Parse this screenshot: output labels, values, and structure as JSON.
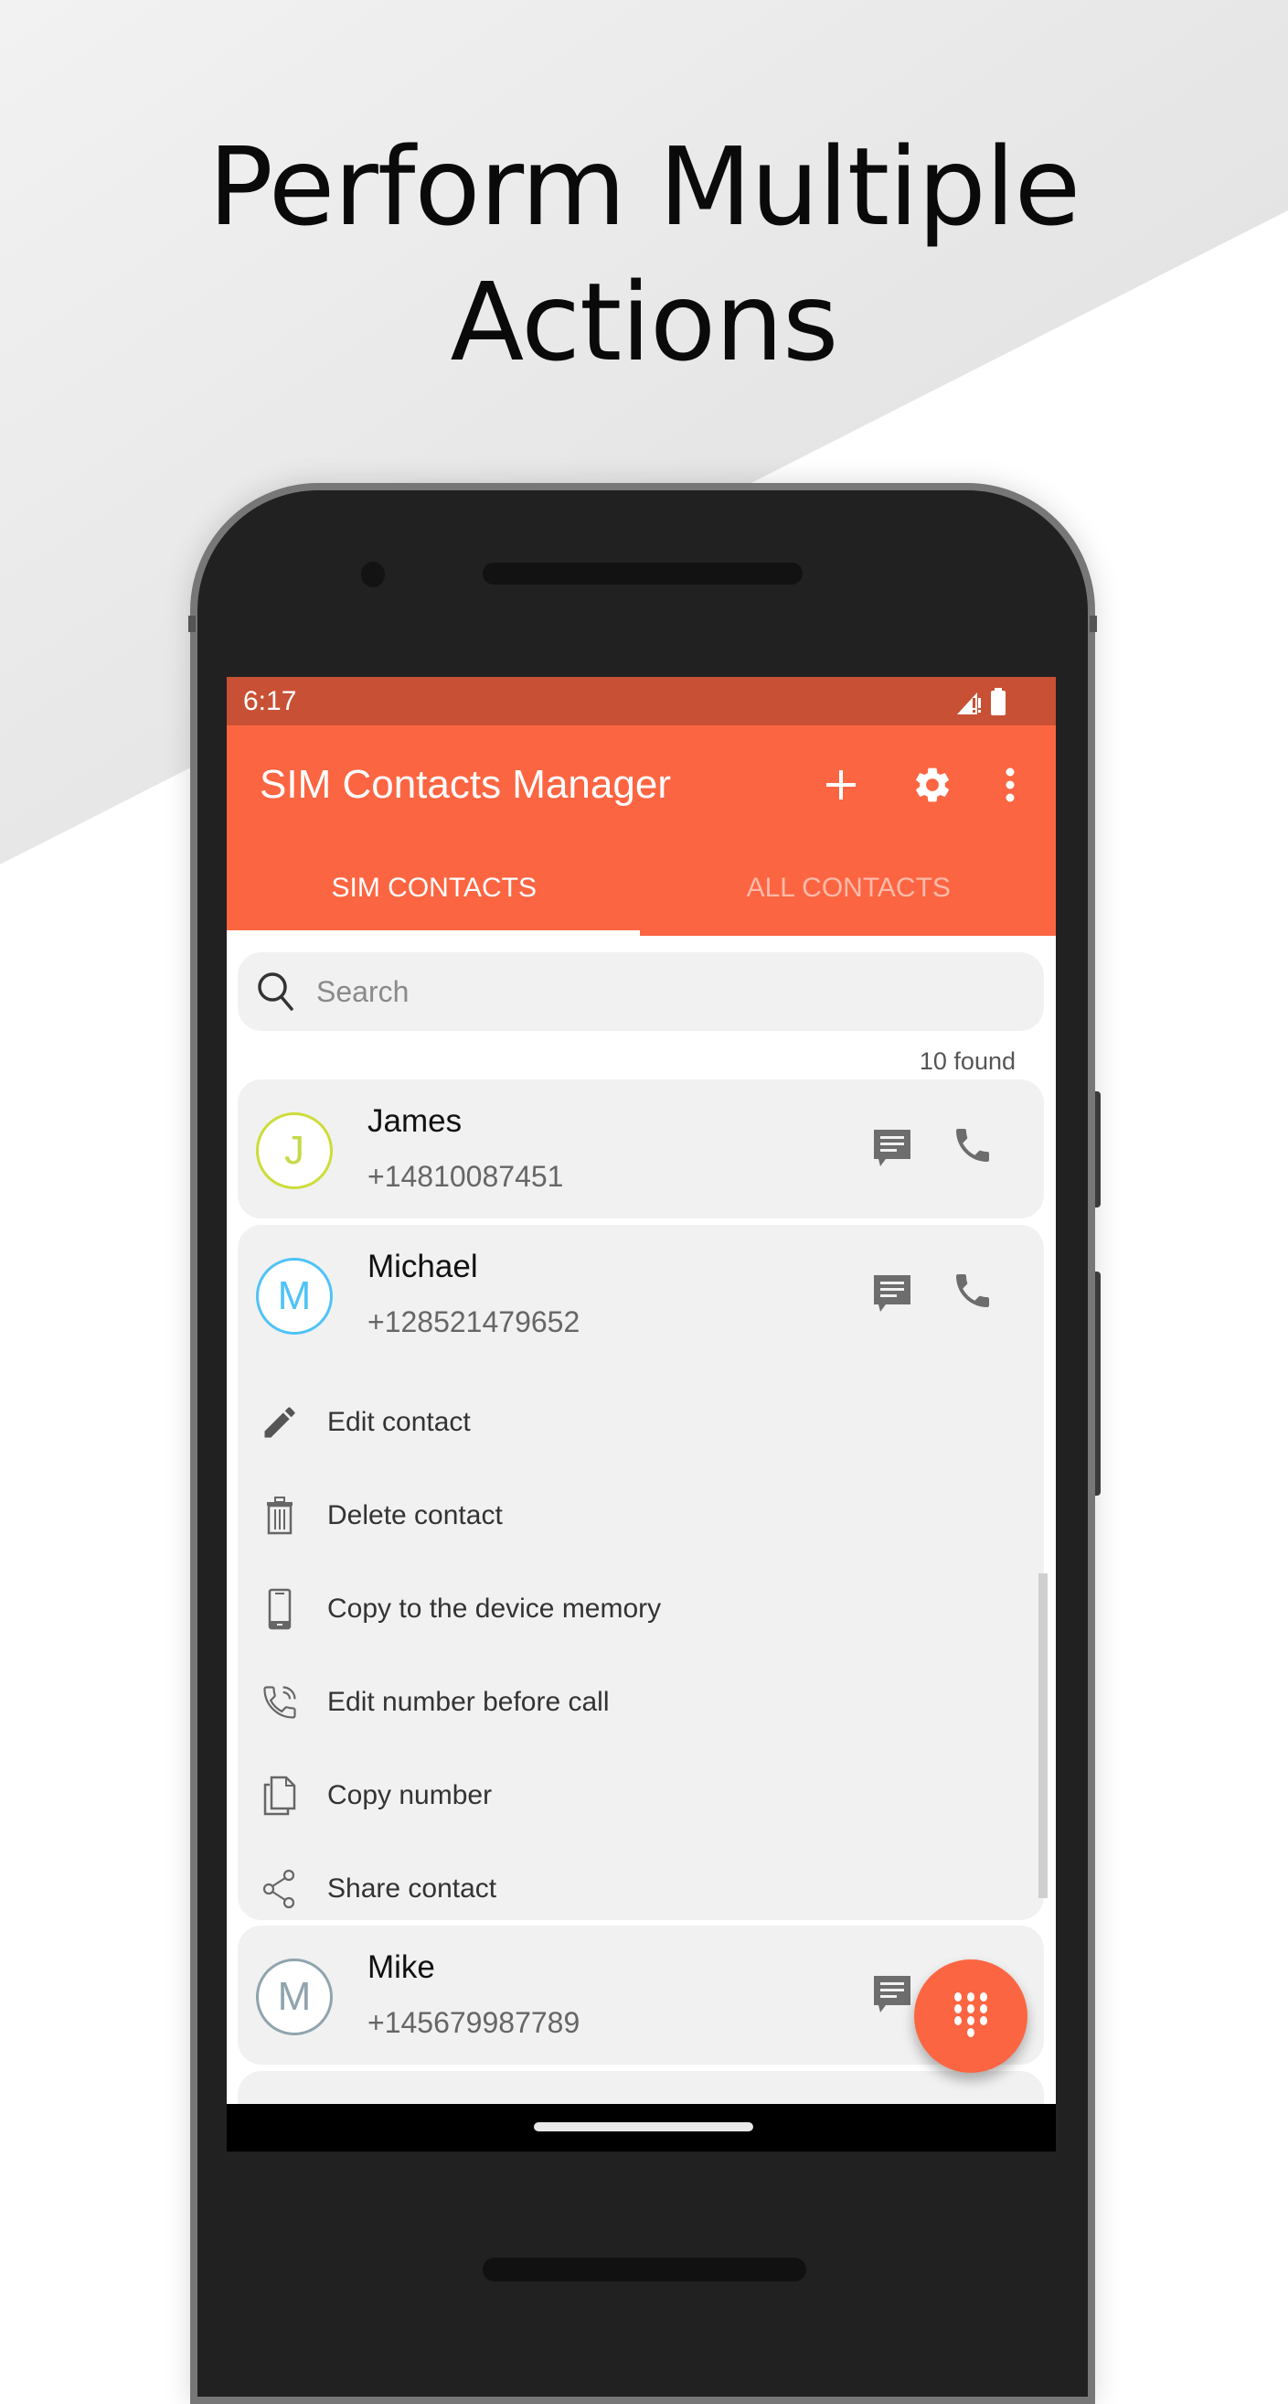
{
  "promo": {
    "headline_line1": "Perform Multiple",
    "headline_line2": "Actions"
  },
  "status_bar": {
    "time": "6:17",
    "icons": [
      "signal-no-service-icon",
      "battery-icon"
    ]
  },
  "app_bar": {
    "title": "SIM Contacts Manager",
    "actions": [
      {
        "name": "add-icon",
        "label": "Add contact"
      },
      {
        "name": "settings-icon",
        "label": "Settings"
      },
      {
        "name": "more-vert-icon",
        "label": "More options"
      }
    ]
  },
  "tabs": [
    {
      "label": "SIM CONTACTS",
      "active": true
    },
    {
      "label": "ALL CONTACTS",
      "active": false
    }
  ],
  "search": {
    "placeholder": "Search",
    "value": ""
  },
  "results_count": "10 found",
  "contacts": [
    {
      "initial": "J",
      "name": "James",
      "phone": "+14810087451",
      "ring_color": "#CDDC39",
      "initial_color": "#C6D94A",
      "expanded": false
    },
    {
      "initial": "M",
      "name": "Michael",
      "phone": "+128521479652",
      "ring_color": "#4FC3F7",
      "initial_color": "#4FC3F7",
      "expanded": true
    },
    {
      "initial": "M",
      "name": "Mike",
      "phone": "+145679987789",
      "ring_color": "#90A4AE",
      "initial_color": "#90A4AE",
      "expanded": false
    }
  ],
  "context_menu": [
    {
      "icon": "pencil-icon",
      "label": "Edit contact"
    },
    {
      "icon": "trash-icon",
      "label": "Delete contact"
    },
    {
      "icon": "smartphone-icon",
      "label": "Copy to the device memory"
    },
    {
      "icon": "phone-ringing-icon",
      "label": "Edit number before call"
    },
    {
      "icon": "copy-icon",
      "label": "Copy number"
    },
    {
      "icon": "share-icon",
      "label": "Share contact"
    }
  ],
  "fab": {
    "icon": "dialpad-icon",
    "label": "Dialpad"
  },
  "colors": {
    "primary": "#FC6541",
    "primary_dark": "#C85034",
    "card_bg": "#F1F1F1"
  }
}
